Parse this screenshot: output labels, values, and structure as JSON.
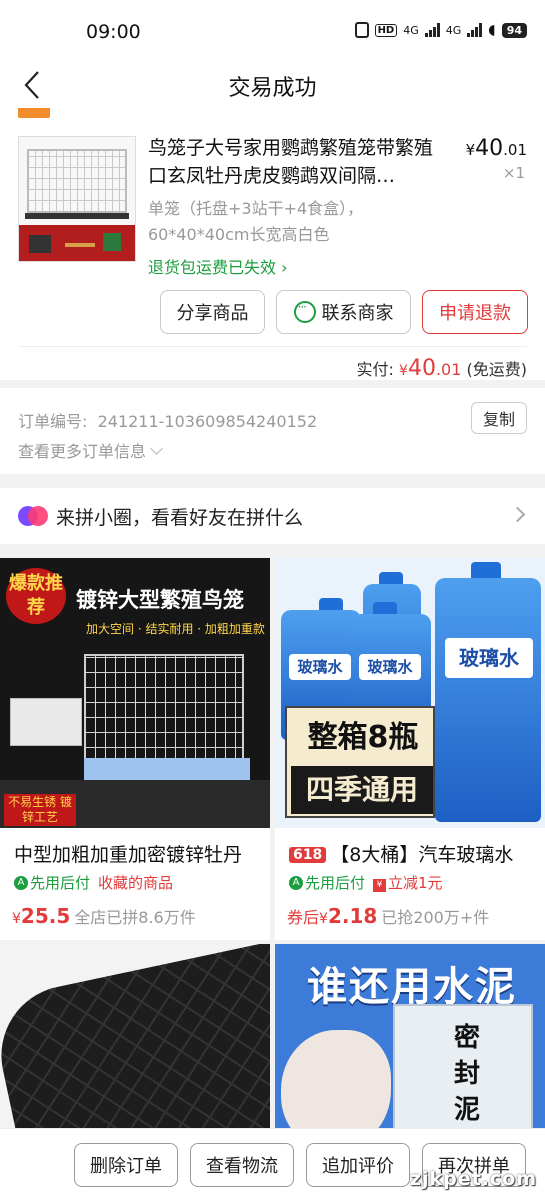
{
  "status_bar": {
    "time": "09:00",
    "signal_labels": [
      "HD",
      "4G",
      "4G"
    ],
    "battery": "94"
  },
  "nav": {
    "title": "交易成功"
  },
  "order_item": {
    "title": "鸟笼子大号家用鹦鹉繁殖笼带繁殖口玄凤牡丹虎皮鹦鹉双间隔…",
    "price_symbol": "¥",
    "price_int": "40",
    "price_dec": ".01",
    "quantity": "×1",
    "spec": "单笼（托盘+3站干+4食盒），60*40*40cm长宽高白色",
    "refund_note": "退货包运费已失效",
    "buttons": {
      "share": "分享商品",
      "contact": "联系商家",
      "refund": "申请退款"
    },
    "paid_label": "实付:",
    "paid_symbol": "¥",
    "paid_int": "40",
    "paid_dec": ".01",
    "paid_note": "(免运费)"
  },
  "order_info": {
    "order_no_label": "订单编号:",
    "order_no": "241211-103609854240152",
    "copy_label": "复制",
    "more_label": "查看更多订单信息"
  },
  "circle": {
    "text": "来拼小圈，看看好友在拼什么"
  },
  "products": [
    {
      "image_badge": "爆款推荐",
      "image_headline": "镀锌大型繁殖鸟笼",
      "image_sub": "加大空间 · 结实耐用 · 加粗加重款",
      "image_tag": "不易生锈 镀锌工艺",
      "badge": "",
      "name": "中型加粗加重加密镀锌牡丹",
      "tag1": "先用后付",
      "tag2": "收藏的商品",
      "price_prefix": "",
      "price_symbol": "¥",
      "price": "25.5",
      "sales": "全店已拼8.6万件"
    },
    {
      "image_label": "玻璃水",
      "image_big1": "整箱8瓶",
      "image_big2": "四季通用",
      "badge": "618",
      "name": "【8大桶】汽车玻璃水",
      "tag1": "先用后付",
      "tag2": "立减1元",
      "price_prefix": "券后",
      "price_symbol": "¥",
      "price": "2.18",
      "sales": "已抢200万+件"
    },
    {
      "name": ""
    },
    {
      "image_headline": "谁还用水泥",
      "image_pack": "密封泥"
    }
  ],
  "bottom_bar": {
    "delete": "删除订单",
    "logistics": "查看物流",
    "review": "追加评价",
    "reorder": "再次拼单"
  },
  "watermark": "zjkpet.com",
  "colors": {
    "accent_red": "#e23b3b",
    "green": "#1a9e3f",
    "muted_gray": "#999999"
  },
  "icons": [
    "back-arrow-icon",
    "chat-icon",
    "chevron-right-icon",
    "chevron-down-icon",
    "circle-logo-icon"
  ]
}
